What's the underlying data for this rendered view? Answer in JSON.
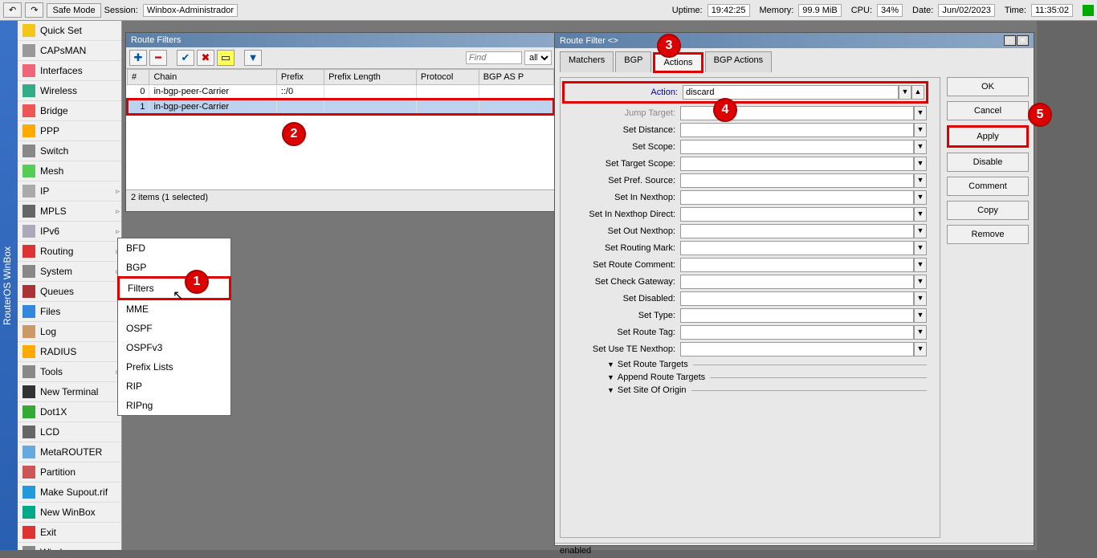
{
  "topbar": {
    "safemode": "Safe Mode",
    "session_label": "Session:",
    "session": "Winbox-Administrador",
    "uptime_label": "Uptime:",
    "uptime": "19:42:25",
    "memory_label": "Memory:",
    "memory": "99.9 MiB",
    "cpu_label": "CPU:",
    "cpu": "34%",
    "date_label": "Date:",
    "date": "Jun/02/2023",
    "time_label": "Time:",
    "time": "11:35:02"
  },
  "leftstrip": "RouterOS WinBox",
  "sidebar": [
    {
      "label": "Quick Set",
      "icon": "#f5c518"
    },
    {
      "label": "CAPsMAN",
      "icon": "#999"
    },
    {
      "label": "Interfaces",
      "icon": "#e67"
    },
    {
      "label": "Wireless",
      "icon": "#3a8"
    },
    {
      "label": "Bridge",
      "icon": "#e55"
    },
    {
      "label": "PPP",
      "icon": "#fa0"
    },
    {
      "label": "Switch",
      "icon": "#888"
    },
    {
      "label": "Mesh",
      "icon": "#5c5"
    },
    {
      "label": "IP",
      "icon": "#aaa",
      "sub": true
    },
    {
      "label": "MPLS",
      "icon": "#666",
      "sub": true
    },
    {
      "label": "IPv6",
      "icon": "#aab",
      "sub": true
    },
    {
      "label": "Routing",
      "icon": "#d33",
      "sub": true
    },
    {
      "label": "System",
      "icon": "#888",
      "sub": true
    },
    {
      "label": "Queues",
      "icon": "#a33"
    },
    {
      "label": "Files",
      "icon": "#38d"
    },
    {
      "label": "Log",
      "icon": "#c96"
    },
    {
      "label": "RADIUS",
      "icon": "#fa0"
    },
    {
      "label": "Tools",
      "icon": "#888",
      "sub": true
    },
    {
      "label": "New Terminal",
      "icon": "#333"
    },
    {
      "label": "Dot1X",
      "icon": "#3a3"
    },
    {
      "label": "LCD",
      "icon": "#666"
    },
    {
      "label": "MetaROUTER",
      "icon": "#6ad"
    },
    {
      "label": "Partition",
      "icon": "#c55"
    },
    {
      "label": "Make Supout.rif",
      "icon": "#29d"
    },
    {
      "label": "New WinBox",
      "icon": "#0a8"
    },
    {
      "label": "Exit",
      "icon": "#d33"
    },
    {
      "label": "Windows",
      "icon": "#888",
      "sub": true
    }
  ],
  "flyout": [
    "BFD",
    "BGP",
    "Filters",
    "MME",
    "OSPF",
    "OSPFv3",
    "Prefix Lists",
    "RIP",
    "RIPng"
  ],
  "win1": {
    "title": "Route Filters",
    "find_placeholder": "Find",
    "all": "all",
    "cols": [
      "#",
      "Chain",
      "Prefix",
      "Prefix Length",
      "Protocol",
      "BGP AS P"
    ],
    "rows": [
      {
        "n": "0",
        "chain": "in-bgp-peer-Carrier",
        "prefix": "::/0"
      },
      {
        "n": "1",
        "chain": "in-bgp-peer-Carrier",
        "prefix": ""
      }
    ],
    "status": "2 items (1 selected)"
  },
  "win2": {
    "title": "Route Filter <>",
    "tabs": [
      "Matchers",
      "BGP",
      "Actions",
      "BGP Actions"
    ],
    "action_label": "Action:",
    "action_value": "discard",
    "fields": [
      "Jump Target:",
      "Set Distance:",
      "Set Scope:",
      "Set Target Scope:",
      "Set Pref. Source:",
      "Set In Nexthop:",
      "Set In Nexthop Direct:",
      "Set Out Nexthop:",
      "Set Routing Mark:",
      "Set Route Comment:",
      "Set Check Gateway:",
      "Set Disabled:",
      "Set Type:",
      "Set Route Tag:",
      "Set Use TE Nexthop:"
    ],
    "collapses": [
      "Set Route Targets",
      "Append Route Targets",
      "Set Site Of Origin"
    ],
    "buttons": [
      "OK",
      "Cancel",
      "Apply",
      "Disable",
      "Comment",
      "Copy",
      "Remove"
    ],
    "footer": "enabled"
  },
  "badges": {
    "b1": "1",
    "b2": "2",
    "b3": "3",
    "b4": "4",
    "b5": "5"
  }
}
